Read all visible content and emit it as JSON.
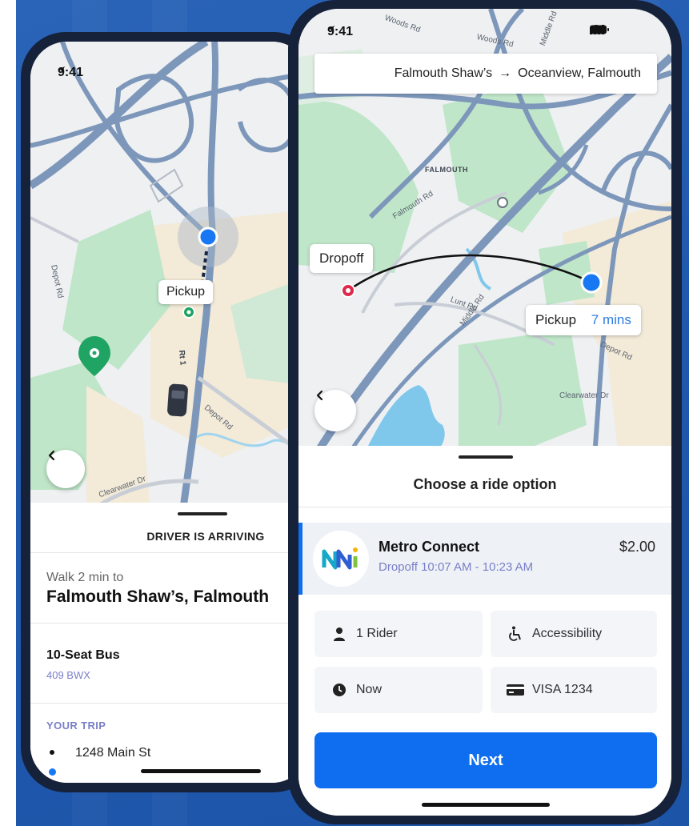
{
  "left_phone": {
    "status_time": "9:41",
    "map_labels": {
      "depot_rd_vertical": "Depot Rd",
      "rt1": "Rt 1",
      "depot_rd": "Depot Rd",
      "clearwater_dr": "Clearwater Dr"
    },
    "pickup_callout": "Pickup",
    "status_heading": "DRIVER IS ARRIVING",
    "walk_text": "Walk 2 min to",
    "destination": "Falmouth Shaw’s, Falmouth",
    "vehicle_name": "10-Seat Bus",
    "vehicle_plate": "409 BWX",
    "trip_heading": "YOUR TRIP",
    "trip_stops": [
      "1248 Main St"
    ]
  },
  "right_phone": {
    "status_time": "9:41",
    "route_origin": "Falmouth Shaw’s",
    "route_arrow": "→",
    "route_destination": "Oceanview, Falmouth",
    "map_labels": {
      "woods_rd": "Woods Rd",
      "woods_rd_2": "Woods Rd",
      "middle_rd": "Middle Rd",
      "falmouth": "FALMOUTH",
      "falmouth_rd": "Falmouth Rd",
      "middle_rd_2": "Middle Rd",
      "lunt_rd": "Lunt Rd",
      "depot_rd": "Depot Rd",
      "clearwater_dr": "Clearwater Dr"
    },
    "dropoff_callout": "Dropoff",
    "pickup_callout": "Pickup",
    "pickup_eta": "7 mins",
    "sheet_title": "Choose a ride option",
    "ride_option": {
      "name": "Metro Connect",
      "dropoff_window": "Dropoff 10:07 AM - 10:23 AM",
      "price": "$2.00"
    },
    "tiles": {
      "riders": "1 Rider",
      "accessibility": "Accessibility",
      "time": "Now",
      "payment": "VISA 1234"
    },
    "next_button": "Next"
  },
  "icons": {
    "back": "chevron-left-icon",
    "navigation": "location-arrow-icon",
    "rider": "person-icon",
    "accessibility": "wheelchair-icon",
    "clock": "clock-icon",
    "card": "credit-card-icon",
    "cellular": "cellular-signal-icon",
    "wifi": "wifi-icon",
    "battery": "battery-icon"
  },
  "colors": {
    "accent_blue": "#0f6ef0",
    "pickup_dot": "#1877f2",
    "dropoff_red": "#e0284a",
    "stop_green": "#1fa463",
    "eta_text": "#2f7de1",
    "map_green": "#bfe6c8",
    "map_water": "#7fc8ec",
    "map_land": "#f3ead8",
    "road": "#7d97bb"
  }
}
